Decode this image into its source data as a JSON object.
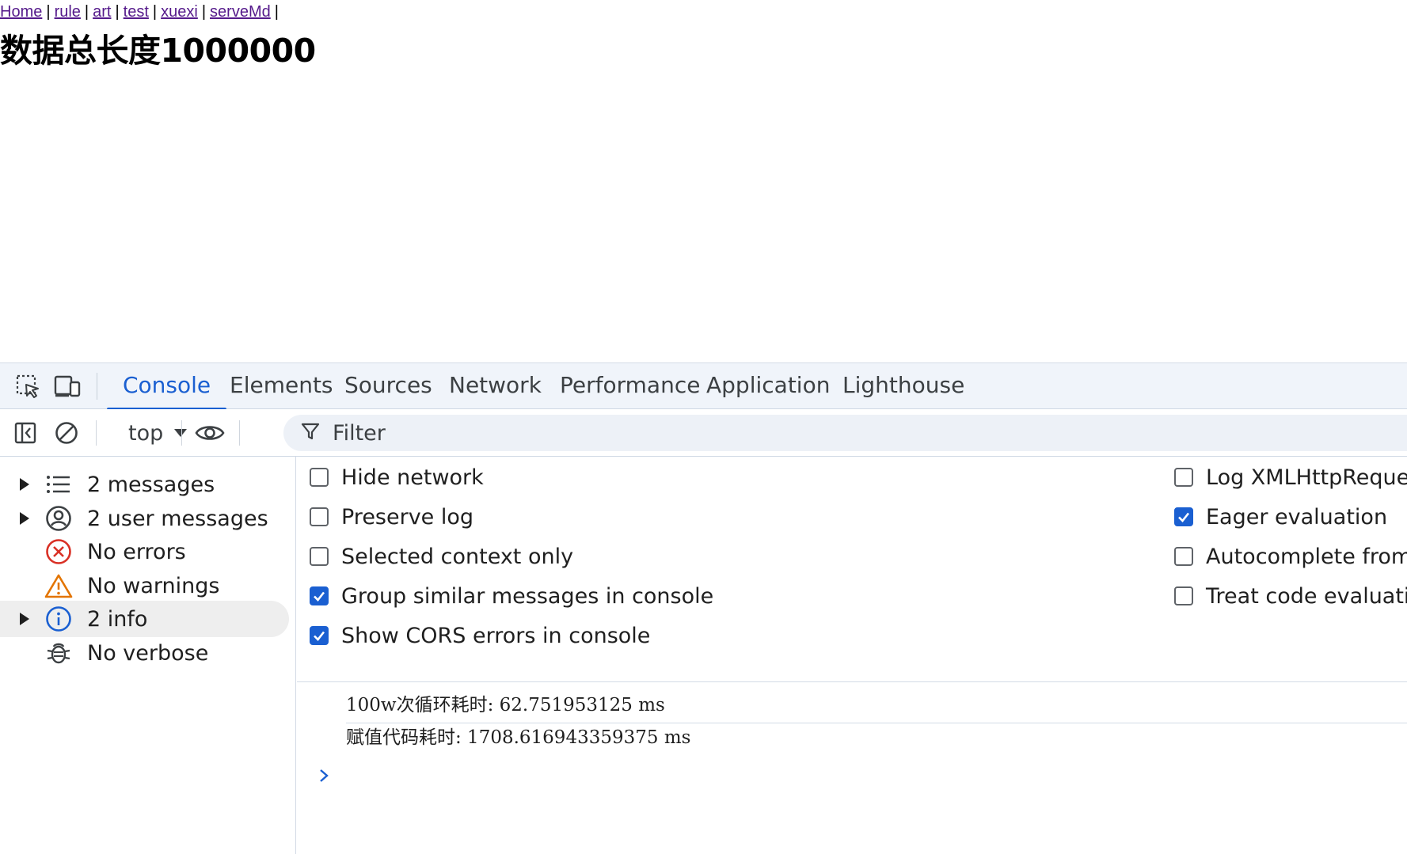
{
  "page": {
    "nav_links": [
      "Home",
      "rule",
      "art",
      "test",
      "xuexi",
      "serveMd"
    ],
    "nav_separator": "|",
    "heading": "数据总长度1000000"
  },
  "devtools": {
    "tabs": [
      "Console",
      "Elements",
      "Sources",
      "Network",
      "Performance",
      "Application",
      "Lighthouse"
    ],
    "active_tab": "Console",
    "toolbar": {
      "context": "top",
      "filter_placeholder": "Filter"
    },
    "sidebar": {
      "items": [
        {
          "label": "2 messages",
          "icon": "list-icon",
          "expandable": true
        },
        {
          "label": "2 user messages",
          "icon": "user-icon",
          "expandable": true
        },
        {
          "label": "No errors",
          "icon": "error-icon",
          "expandable": false
        },
        {
          "label": "No warnings",
          "icon": "warning-icon",
          "expandable": false
        },
        {
          "label": "2 info",
          "icon": "info-icon",
          "expandable": true,
          "selected": true
        },
        {
          "label": "No verbose",
          "icon": "bug-icon",
          "expandable": false
        }
      ]
    },
    "settings": {
      "left": [
        {
          "label": "Hide network",
          "checked": false
        },
        {
          "label": "Preserve log",
          "checked": false
        },
        {
          "label": "Selected context only",
          "checked": false
        },
        {
          "label": "Group similar messages in console",
          "checked": true
        },
        {
          "label": "Show CORS errors in console",
          "checked": true
        }
      ],
      "right": [
        {
          "label": "Log XMLHttpReques",
          "checked": false
        },
        {
          "label": "Eager evaluation",
          "checked": true
        },
        {
          "label": "Autocomplete from",
          "checked": false
        },
        {
          "label": "Treat code evaluatio",
          "checked": false
        }
      ]
    },
    "console_messages": [
      "100w次循环耗时: 62.751953125 ms",
      "赋值代码耗时: 1708.616943359375 ms"
    ],
    "colors": {
      "accent": "#1a5fd1",
      "tabbar_bg": "#f0f4fa",
      "error": "#d93025",
      "warning": "#e37400",
      "info": "#1a5fd1"
    }
  }
}
